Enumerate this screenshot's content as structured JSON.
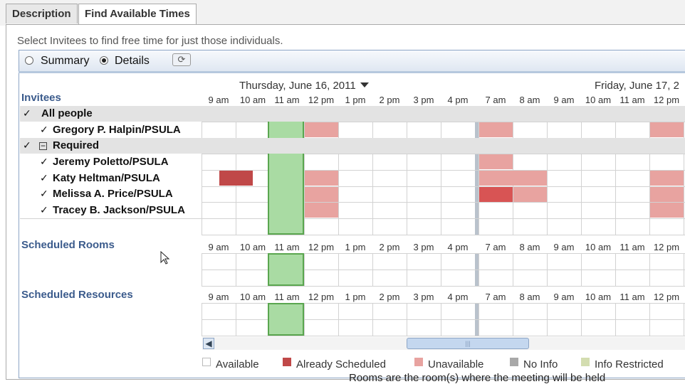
{
  "tabs": [
    {
      "label": "Description",
      "active": false
    },
    {
      "label": "Find Available Times",
      "active": true
    }
  ],
  "instruction": "Select Invitees to find free time for just those individuals.",
  "view": {
    "summary_label": "Summary",
    "details_label": "Details",
    "selected": "Details"
  },
  "days": [
    {
      "label": "Thursday, June 16, 2011",
      "has_dropdown": true
    },
    {
      "label": "Friday, June 17, 2"
    }
  ],
  "hours": [
    "9 am",
    "10 am",
    "11 am",
    "12 pm",
    "1 pm",
    "2 pm",
    "3 pm",
    "4 pm",
    "7 am",
    "8 am",
    "9 am",
    "10 am",
    "11 am",
    "12 pm"
  ],
  "sections": {
    "invitees": "Invitees",
    "rooms": "Scheduled Rooms",
    "resources": "Scheduled Resources"
  },
  "invitees": [
    {
      "name": "All people",
      "checked": true,
      "group": true
    },
    {
      "name": "Gregory P. Halpin/PSULA",
      "checked": true
    },
    {
      "name": "Required",
      "checked": true,
      "group": true,
      "collapsible": true
    },
    {
      "name": "Jeremy Poletto/PSULA",
      "checked": true
    },
    {
      "name": "Katy Heltman/PSULA",
      "checked": true
    },
    {
      "name": "Melissa A. Price/PSULA",
      "checked": true
    },
    {
      "name": "Tracey B. Jackson/PSULA",
      "checked": true
    }
  ],
  "legend": [
    "Available",
    "Already Scheduled",
    "Unavailable",
    "No Info",
    "Info Restricted"
  ],
  "footer_text": "Rooms are the room(s) where the meeting will be held",
  "colors": {
    "already_scheduled": "#c04848",
    "unavailable": "#e8a3a0",
    "no_info": "#a8a8a8",
    "info_restricted": "#d3ddb0",
    "available_slot": "#a9dba3",
    "section_title": "#3b5b8c"
  }
}
